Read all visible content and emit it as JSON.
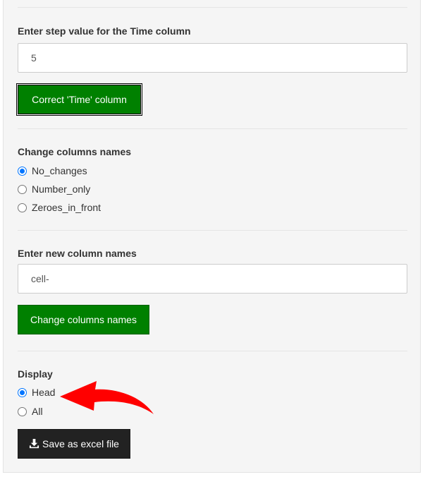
{
  "step_section": {
    "label": "Enter step value for the Time column",
    "value": "5",
    "button_label": "Correct 'Time' column"
  },
  "rename_section": {
    "label": "Change columns names",
    "options": [
      "No_changes",
      "Number_only",
      "Zeroes_in_front"
    ],
    "selected": "No_changes"
  },
  "new_names_section": {
    "label": "Enter new column names",
    "value": "cell-",
    "button_label": "Change columns names"
  },
  "display_section": {
    "label": "Display",
    "options": [
      "Head",
      "All"
    ],
    "selected": "Head"
  },
  "save_button": {
    "label": "Save as excel file",
    "icon": "download-icon"
  },
  "annotation": {
    "icon": "red-curved-arrow-icon",
    "color": "#ff0000"
  },
  "colors": {
    "green_button": "#008000",
    "dark_button": "#222222",
    "radio_accent": "#0075ff",
    "panel_background": "#f5f5f5"
  }
}
